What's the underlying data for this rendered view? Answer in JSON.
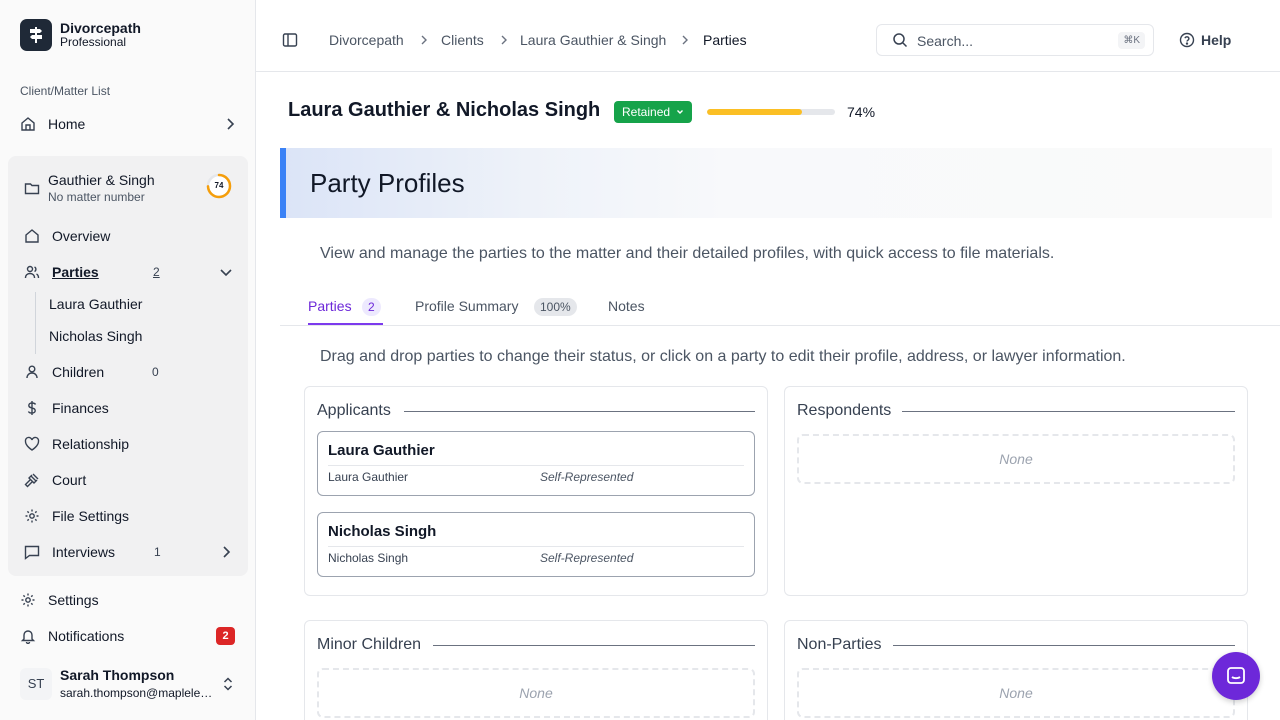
{
  "brand": {
    "name": "Divorcepath",
    "plan": "Professional"
  },
  "sidebar": {
    "section_label": "Client/Matter List",
    "home": "Home",
    "matter": {
      "title": "Gauthier & Singh",
      "subtitle": "No matter number",
      "progress": "74"
    },
    "items": [
      {
        "label": "Overview",
        "icon": "eye-icon"
      },
      {
        "label": "Parties",
        "icon": "users-icon",
        "count": "2"
      },
      {
        "label": "Children",
        "icon": "person-icon",
        "count": "0"
      },
      {
        "label": "Finances",
        "icon": "dollar-icon"
      },
      {
        "label": "Relationship",
        "icon": "heart-icon"
      },
      {
        "label": "Court",
        "icon": "gavel-icon"
      },
      {
        "label": "File Settings",
        "icon": "gear-icon"
      },
      {
        "label": "Interviews",
        "icon": "chat-icon",
        "count": "1"
      }
    ],
    "parties_sub": [
      "Laura Gauthier",
      "Nicholas Singh"
    ],
    "settings": "Settings",
    "notifications": {
      "label": "Notifications",
      "count": "2"
    },
    "user": {
      "initials": "ST",
      "name": "Sarah Thompson",
      "email": "sarah.thompson@mapleleaflaw.ca"
    }
  },
  "topbar": {
    "breadcrumb": [
      "Divorcepath",
      "Clients",
      "Laura Gauthier & Singh",
      "Parties"
    ],
    "search_placeholder": "Search...",
    "shortcut": "⌘K",
    "help": "Help"
  },
  "header": {
    "client": "Laura Gauthier & Nicholas Singh",
    "status": "Retained",
    "progress_value": 0.74,
    "progress_label": "74%"
  },
  "page": {
    "title": "Party Profiles",
    "description": "View and manage the parties to the matter and their detailed profiles, with quick access to file materials.",
    "tabs": [
      {
        "label": "Parties",
        "badge": "2"
      },
      {
        "label": "Profile Summary",
        "badge": "100%"
      },
      {
        "label": "Notes"
      }
    ],
    "instructions": "Drag and drop parties to change their status, or click on a party to edit their profile, address, or lawyer information."
  },
  "groups": {
    "applicants": {
      "title": "Applicants",
      "parties": [
        {
          "name": "Laura Gauthier",
          "sub": "Laura Gauthier",
          "rep": "Self-Represented"
        },
        {
          "name": "Nicholas Singh",
          "sub": "Nicholas Singh",
          "rep": "Self-Represented"
        }
      ]
    },
    "respondents": {
      "title": "Respondents",
      "empty": "None"
    },
    "minor_children": {
      "title": "Minor Children",
      "empty": "None"
    },
    "non_parties": {
      "title": "Non-Parties",
      "empty": "None"
    }
  },
  "colors": {
    "accent": "#6d28d9",
    "status": "#16a34a",
    "progress": "#fbbf24",
    "hero_bar": "#3b82f6"
  }
}
